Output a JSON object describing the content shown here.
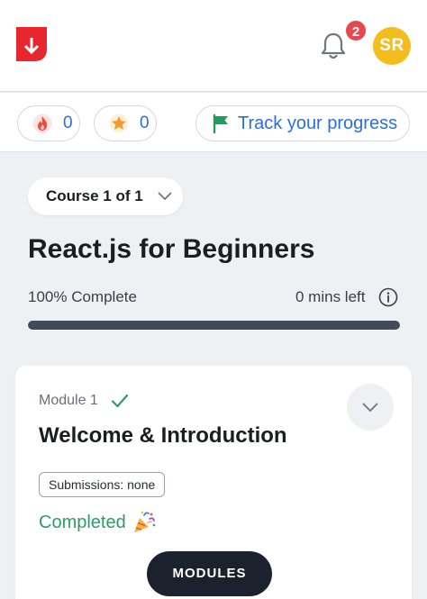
{
  "header": {
    "logo_icon": "brand-logo-icon",
    "notifications": {
      "icon": "bell-icon",
      "count": "2"
    },
    "avatar_initials": "SR"
  },
  "stats": {
    "streak": {
      "icon": "fire-icon",
      "value": "0"
    },
    "stars": {
      "icon": "star-icon",
      "value": "0"
    },
    "track": {
      "icon": "flag-icon",
      "label": "Track your progress"
    }
  },
  "course": {
    "selector_label": "Course 1 of 1",
    "title": "React.js for Beginners",
    "progress_label": "100% Complete",
    "progress_fraction": 1.0,
    "time_left": "0 mins left"
  },
  "module": {
    "number_label": "Module 1",
    "title": "Welcome & Introduction",
    "submissions": "Submissions: none",
    "status": "Completed"
  },
  "footer": {
    "modules_button": "MODULES"
  },
  "colors": {
    "accent_blue": "#2b6de6",
    "success_green": "#2e9b6b",
    "badge_red": "#e5484d",
    "avatar_yellow": "#f2bd1d",
    "brand_red": "#e8262d"
  }
}
